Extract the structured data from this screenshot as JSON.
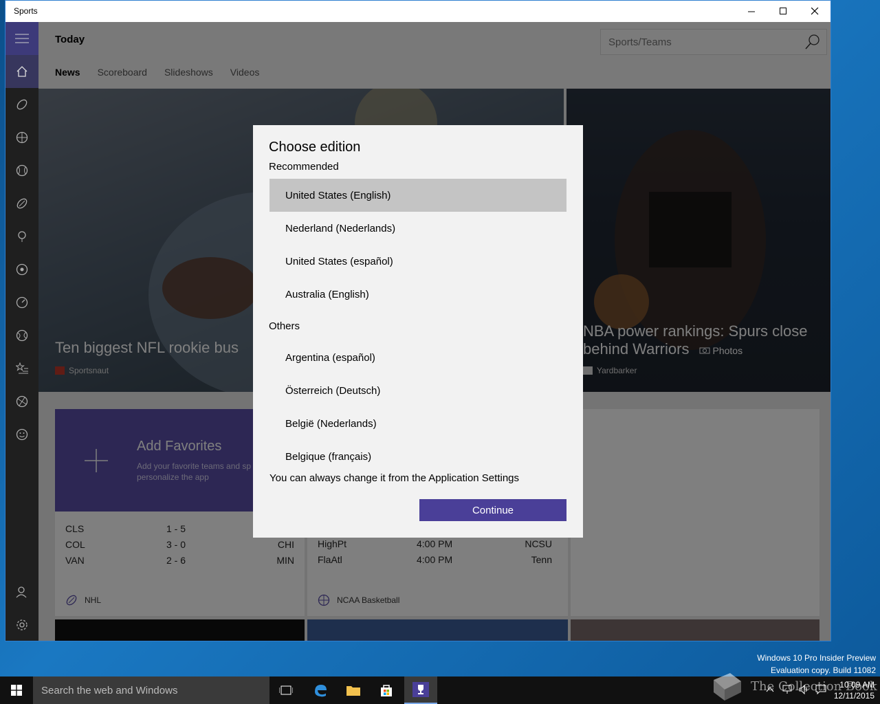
{
  "window": {
    "title": "Sports"
  },
  "header": {
    "title": "Today",
    "search_placeholder": "Sports/Teams"
  },
  "tabs": [
    "News",
    "Scoreboard",
    "Slideshows",
    "Videos"
  ],
  "rail_icons": [
    "hamburger-icon",
    "home-icon",
    "football-icon",
    "basketball-icon",
    "baseball-icon",
    "hockey-icon",
    "golf-icon",
    "soccer-icon",
    "racing-icon",
    "tennis-icon",
    "fantasy-icon",
    "sports-more-icon",
    "smiley-icon",
    "account-icon",
    "settings-icon"
  ],
  "hero_left": {
    "caption": "Ten biggest NFL rookie bus",
    "source": "Sportsnaut"
  },
  "hero_right": {
    "caption_line1": "NBA power rankings: Spurs close",
    "caption_line2": "behind Warriors",
    "photos_label": "Photos",
    "source": "Yardbarker"
  },
  "favorites": {
    "title": "Add Favorites",
    "desc": "Add your favorite teams and sp personalize the app"
  },
  "nhl": {
    "rows": [
      {
        "a": "CLS",
        "score": "1  -  5",
        "b": ""
      },
      {
        "a": "COL",
        "score": "3  -  0",
        "b": "CHI"
      },
      {
        "a": "VAN",
        "score": "2  -  6",
        "b": "MIN"
      }
    ],
    "league": "NHL"
  },
  "ncaa": {
    "rows": [
      {
        "a": "HighPt",
        "time": "4:00 PM",
        "b": "NCSU"
      },
      {
        "a": "FlaAtl",
        "time": "4:00 PM",
        "b": "Tenn"
      }
    ],
    "league": "NCAA Basketball"
  },
  "dialog": {
    "title": "Choose edition",
    "recommended_label": "Recommended",
    "recommended": [
      "United States (English)",
      "Nederland (Nederlands)",
      "United States (español)",
      "Australia (English)"
    ],
    "others_label": "Others",
    "others": [
      "Argentina (español)",
      "Österreich (Deutsch)",
      "België (Nederlands)",
      "Belgique (français)"
    ],
    "hint": "You can always change it from the Application Settings",
    "continue_label": "Continue"
  },
  "taskbar": {
    "search_placeholder": "Search the web and Windows",
    "time": "10:09 AM",
    "date": "12/11/2015"
  },
  "watermark": {
    "line1": "Windows 10 Pro Insider Preview",
    "line2": "Evaluation copy. Build 11082"
  },
  "brand_text": "The Collection Book",
  "colors": {
    "accent": "#4a3f98",
    "rail": "#1f1f1f",
    "selected_option": "#c4c4c4"
  }
}
